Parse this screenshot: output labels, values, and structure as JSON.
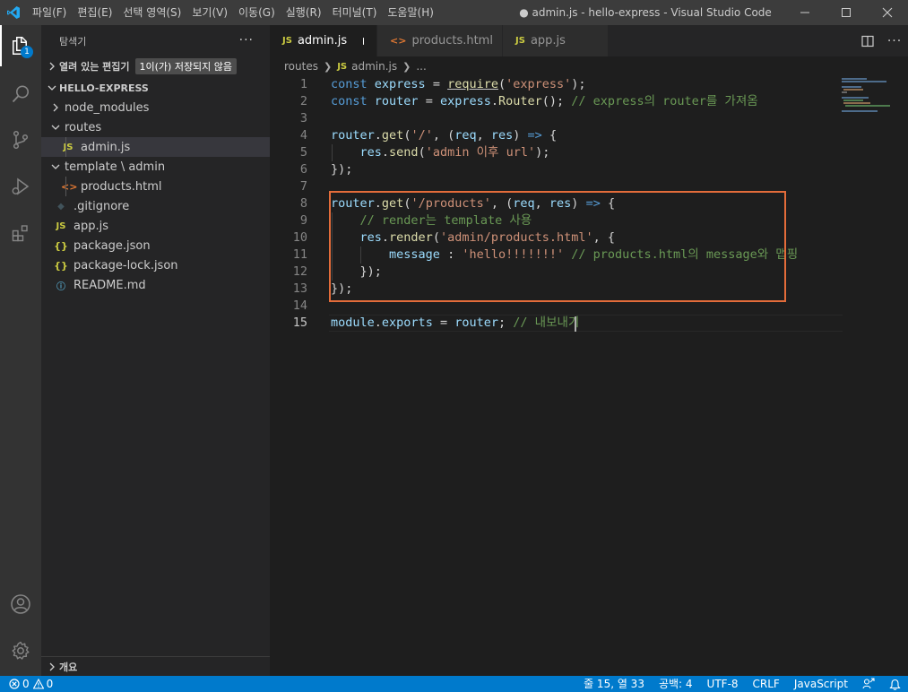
{
  "window": {
    "title": "● admin.js - hello-express - Visual Studio Code",
    "menu": [
      "파일(F)",
      "편집(E)",
      "선택 영역(S)",
      "보기(V)",
      "이동(G)",
      "실행(R)",
      "터미널(T)",
      "도움말(H)"
    ]
  },
  "activity": {
    "explorer_badge": "1"
  },
  "sidebar": {
    "title": "탐색기",
    "more": "···",
    "open_editors": {
      "label": "열려 있는 편집기",
      "badge": "1이(가) 저장되지 않음"
    },
    "project": "HELLO-EXPRESS",
    "tree": [
      {
        "label": "node_modules",
        "kind": "folder-closed"
      },
      {
        "label": "routes",
        "kind": "folder-open"
      },
      {
        "label": "admin.js",
        "kind": "js",
        "icon": "JS"
      },
      {
        "label": "template \\ admin",
        "kind": "folder-open"
      },
      {
        "label": "products.html",
        "kind": "html",
        "icon": "<>"
      },
      {
        "label": ".gitignore",
        "kind": "git",
        "icon": "◆"
      },
      {
        "label": "app.js",
        "kind": "js",
        "icon": "JS"
      },
      {
        "label": "package.json",
        "kind": "json",
        "icon": "{}"
      },
      {
        "label": "package-lock.json",
        "kind": "json",
        "icon": "{}"
      },
      {
        "label": "README.md",
        "kind": "info",
        "icon": "ⓘ"
      }
    ],
    "outline": "개요"
  },
  "tabs": [
    {
      "label": "admin.js",
      "icon": "JS",
      "active": true,
      "modified": true
    },
    {
      "label": "products.html",
      "icon": "<>",
      "active": false
    },
    {
      "label": "app.js",
      "icon": "JS",
      "active": false
    }
  ],
  "breadcrumb": {
    "folder": "routes",
    "file": "admin.js",
    "more": "...",
    "file_icon": "JS"
  },
  "editor": {
    "line_numbers": [
      "1",
      "2",
      "3",
      "4",
      "5",
      "6",
      "7",
      "8",
      "9",
      "10",
      "11",
      "12",
      "13",
      "14",
      "15"
    ],
    "lines": [
      [
        [
          "kw",
          "const "
        ],
        [
          "var",
          "express"
        ],
        [
          "op",
          " = "
        ],
        [
          "fnu",
          "require"
        ],
        [
          "op",
          "("
        ],
        [
          "str",
          "'express'"
        ],
        [
          "op",
          ");"
        ]
      ],
      [
        [
          "kw",
          "const "
        ],
        [
          "var",
          "router"
        ],
        [
          "op",
          " = "
        ],
        [
          "var",
          "express"
        ],
        [
          "op",
          "."
        ],
        [
          "fn",
          "Router"
        ],
        [
          "op",
          "(); "
        ],
        [
          "cmt",
          "// express의 router를 가져옴"
        ]
      ],
      [],
      [
        [
          "var",
          "router"
        ],
        [
          "op",
          "."
        ],
        [
          "fn",
          "get"
        ],
        [
          "op",
          "("
        ],
        [
          "str",
          "'/'"
        ],
        [
          "op",
          ", ("
        ],
        [
          "var",
          "req"
        ],
        [
          "op",
          ", "
        ],
        [
          "var",
          "res"
        ],
        [
          "op",
          ") "
        ],
        [
          "kw",
          "=>"
        ],
        [
          "op",
          " {"
        ]
      ],
      [
        [
          "op",
          "    "
        ],
        [
          "var",
          "res"
        ],
        [
          "op",
          "."
        ],
        [
          "fn",
          "send"
        ],
        [
          "op",
          "("
        ],
        [
          "str",
          "'admin 이후 url'"
        ],
        [
          "op",
          ");"
        ]
      ],
      [
        [
          "op",
          "});"
        ]
      ],
      [],
      [
        [
          "var",
          "router"
        ],
        [
          "op",
          "."
        ],
        [
          "fn",
          "get"
        ],
        [
          "op",
          "("
        ],
        [
          "str",
          "'/products'"
        ],
        [
          "op",
          ", ("
        ],
        [
          "var",
          "req"
        ],
        [
          "op",
          ", "
        ],
        [
          "var",
          "res"
        ],
        [
          "op",
          ") "
        ],
        [
          "kw",
          "=>"
        ],
        [
          "op",
          " {"
        ]
      ],
      [
        [
          "op",
          "    "
        ],
        [
          "cmt",
          "// render는 template 사용"
        ]
      ],
      [
        [
          "op",
          "    "
        ],
        [
          "var",
          "res"
        ],
        [
          "op",
          "."
        ],
        [
          "fn",
          "render"
        ],
        [
          "op",
          "("
        ],
        [
          "str",
          "'admin/products.html'"
        ],
        [
          "op",
          ", {"
        ]
      ],
      [
        [
          "op",
          "        "
        ],
        [
          "var",
          "message"
        ],
        [
          "op",
          " : "
        ],
        [
          "str",
          "'hello!!!!!!!'"
        ],
        [
          "op",
          " "
        ],
        [
          "cmt",
          "// products.html의 message와 맵핑"
        ]
      ],
      [
        [
          "op",
          "    });"
        ]
      ],
      [
        [
          "op",
          "});"
        ]
      ],
      [],
      [
        [
          "var",
          "module"
        ],
        [
          "op",
          "."
        ],
        [
          "var",
          "exports"
        ],
        [
          "op",
          " = "
        ],
        [
          "var",
          "router"
        ],
        [
          "op",
          "; "
        ],
        [
          "cmt",
          "// 내보내기"
        ]
      ]
    ]
  },
  "status": {
    "errors": "0",
    "warnings": "0",
    "position": "줄 15, 열 33",
    "indent": "공백: 4",
    "encoding": "UTF-8",
    "eol": "CRLF",
    "language": "JavaScript"
  }
}
